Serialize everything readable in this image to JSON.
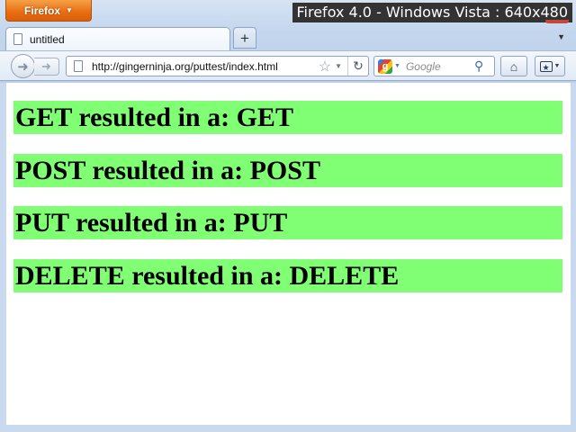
{
  "browser": {
    "menu_button": "Firefox",
    "watermark": "Firefox 4.0 - Windows Vista : 640x480"
  },
  "tabs": [
    {
      "label": "untitled",
      "active": true
    }
  ],
  "new_tab_label": "+",
  "navigation": {
    "url": "http://gingerninja.org/puttest/index.html",
    "search_placeholder": "Google"
  },
  "page": {
    "results": [
      {
        "text": "GET resulted in a: GET"
      },
      {
        "text": "POST resulted in a: POST"
      },
      {
        "text": "PUT resulted in a: PUT"
      },
      {
        "text": "DELETE resulted in a: DELETE"
      }
    ],
    "result_background": "#80ff74"
  },
  "colors": {
    "firefox_button": "#e86c12",
    "chrome": "#c9daf0"
  },
  "icons": [
    "back-icon",
    "forward-icon",
    "page-icon",
    "star-icon",
    "reload-icon",
    "google-icon",
    "search-icon",
    "home-icon",
    "bookmarks-icon"
  ]
}
